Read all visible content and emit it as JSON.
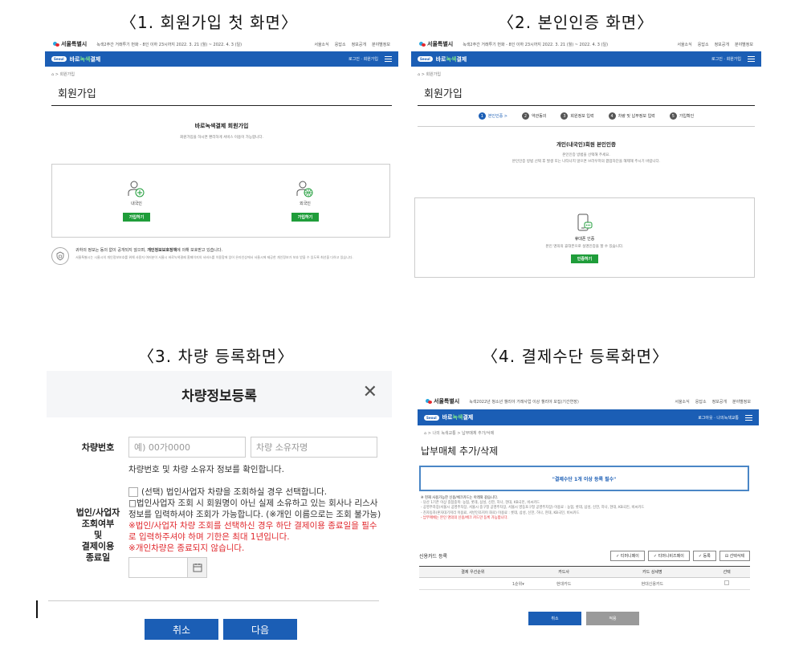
{
  "captions": {
    "c1": "〈1. 회원가입 첫 화면〉",
    "c2": "〈2. 본인인증 화면〉",
    "c3": "〈3. 차량 등록화면〉",
    "c4": "〈4. 결제수단 등록화면〉"
  },
  "site": {
    "city_logo": "서울특별시",
    "brand_prefix": "바로",
    "brand_green": "녹색",
    "brand_suffix": "결제",
    "brand_pill": "Seoul",
    "notice": "녹색2주간 거래투기 번화 - 8인 이하 23시까지 2022. 3. 21 (월) ~ 2022. 4. 3 (일)",
    "links": [
      "서울소식",
      "응답소",
      "정보공개",
      "분야별정보"
    ],
    "login": "로그인 · 회원가입",
    "crumb": "⌂ > 회원가입",
    "title": "회원가입"
  },
  "shot1": {
    "heading": "바로녹색결제 회원가입",
    "subheading": "회원가입을 하시면 편리하게 서비스 이용이 가능합니다.",
    "cards": [
      {
        "label": "내국인",
        "button": "가입하기"
      },
      {
        "label": "외국인",
        "button": "가입하기"
      }
    ],
    "privacy_title_pre": "귀하의 정보는 동의 없이 공개되지 않으며, ",
    "privacy_title_bold": "개인정보보호정책",
    "privacy_title_post": "에 의해 보호받고 있습니다.",
    "privacy_body": "서울특별시는 시울시의 개인정보보호를 위해 사용자 여러분이 서울시 바로녹색결제 홈페이지의 서비스를 이용함에 있어 온라인상에서 서울시에 제공한 개인정보가 보호 받을 수 있도록 최선을 다하고 있습니다."
  },
  "shot2": {
    "steps": [
      "본인인증 >",
      "약관동의",
      "회원정보 입력",
      "차량 및 납부정보 입력",
      "가입확인"
    ],
    "heading": "개인(내국인)회원 본인인증",
    "sub1": "본인인증 방법을 선택해 주세요.",
    "sub2": "본인인증 방법 선택 후 발생 또는 나타나지 않으면 브라우저의 팝업차단을 해제해 주시기 바랍니다.",
    "card_title": "휴대폰 인증",
    "card_desc": "본인 명의의 휴대폰으로 실명인증을 할 수 있습니다.",
    "card_button": "인증하기"
  },
  "shot3": {
    "title": "차량정보등록",
    "close": "✕",
    "label_car": "차량번호",
    "placeholder_car": "예) 00가0000",
    "placeholder_owner": "차량 소유자명",
    "help_car": "차량번호 및 차량 소유자 정보를 확인합니다.",
    "label_corp": "법인/사업자\n조회여부\n및\n결제이용\n종료일",
    "corp_line1": "(선택) 법인사업자 차량을 조회하실 경우 선택합니다.",
    "corp_line2": "□법인사업자 조회 시 회원명이 아닌 실제 소유하고 있는 회사나 리스사",
    "corp_line3": "정보를 입력하셔야 조회가 가능합니다. (※개인 이름으로는 조회 불가능)",
    "corp_red1": "※법인/사업자 차량 조회를 선택하신 경우 하단 결제이용 종료일을 필수",
    "corp_red2": "로 입력하주셔야 하며 기한은 최대 1년입니다.",
    "corp_red3": "※개인차량은 종료되지 않습니다.",
    "cancel": "취소",
    "next": "다음"
  },
  "shot4": {
    "notice": "녹색2022년 청소년 챌리야 거래사업 이상 챌리야 모집(기간연장)",
    "login": "로그아웃 · 나의녹색교통",
    "crumb": "⌂ > 나의 녹색교통 > 납부매체 추가/삭제",
    "title": "납부매체 추가/삭제",
    "boxtext": "\"결제수단 1개 이상 등록 필수\"",
    "notes": [
      "※ 현재 사용가능한 신용/체크카드는 아래와 같습니다.",
      "- 당산 1기존 이상 중점중복: 농협, 롯데, 삼성, 신한, 하나, 현대, KB국민, 비씨카드",
      "- 공영주차장(서울시 공영주차장, 서울시 중구청 공영주차장, 서울시 영등포구청 공영주차장) 이용료 : 농협, 롯데, 삼성, 신한, 하나, 현대, KB국민, 비씨카드",
      "- 친자동차(혼자대기저리 이용료, 서빈인조지이 화로) 이용료 : 롯데, 삼성, 신한, 하나, 현대, KB국민, 비씨카드",
      "- 납부매체는 본인 명의의 신용/체크 카드만 등록 가능합니다."
    ],
    "section": "신용카드 등록",
    "buttons": [
      "✓ 티머니페이",
      "✓ 티머니비즈페이",
      "✓  등록",
      "⊟ 선택삭제"
    ],
    "columns": [
      "결제 우선순위",
      "카드사",
      "카드 상세명",
      "선택"
    ],
    "row": [
      "1순위▾",
      "현대카드",
      "현대신용카드",
      ""
    ],
    "cancel": "취소",
    "save": "적용"
  }
}
